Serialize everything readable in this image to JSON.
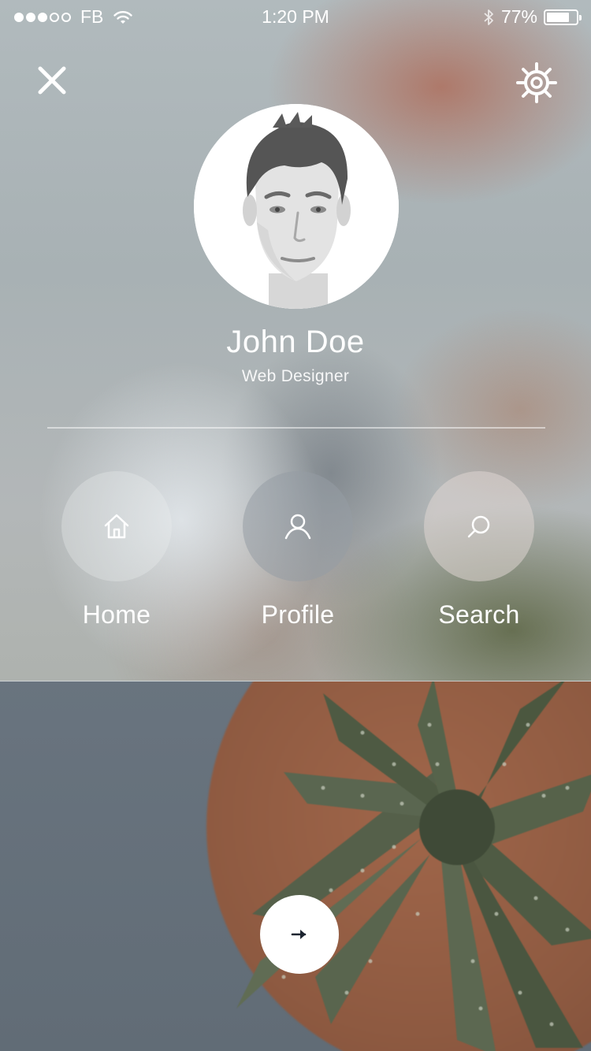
{
  "status_bar": {
    "carrier": "FB",
    "signal_bars_filled": 3,
    "signal_bars_total": 5,
    "time": "1:20 PM",
    "battery_percent": "77%",
    "battery_level": 0.77,
    "icons": [
      "wifi-icon",
      "bluetooth-icon",
      "battery-icon"
    ]
  },
  "header": {
    "close_icon": "close-icon",
    "settings_icon": "settings-icon"
  },
  "profile": {
    "name": "John Doe",
    "role": "Web Designer",
    "avatar_icon": "avatar-photo"
  },
  "nav": {
    "items": [
      {
        "label": "Home",
        "icon": "home-icon"
      },
      {
        "label": "Profile",
        "icon": "user-icon"
      },
      {
        "label": "Search",
        "icon": "search-icon"
      }
    ]
  },
  "footer": {
    "next_icon": "arrow-right-icon"
  },
  "colors": {
    "overlay_tint": "#aab3b6",
    "text": "#ffffff",
    "next_button_bg": "#ffffff",
    "next_arrow": "#1d2430"
  }
}
